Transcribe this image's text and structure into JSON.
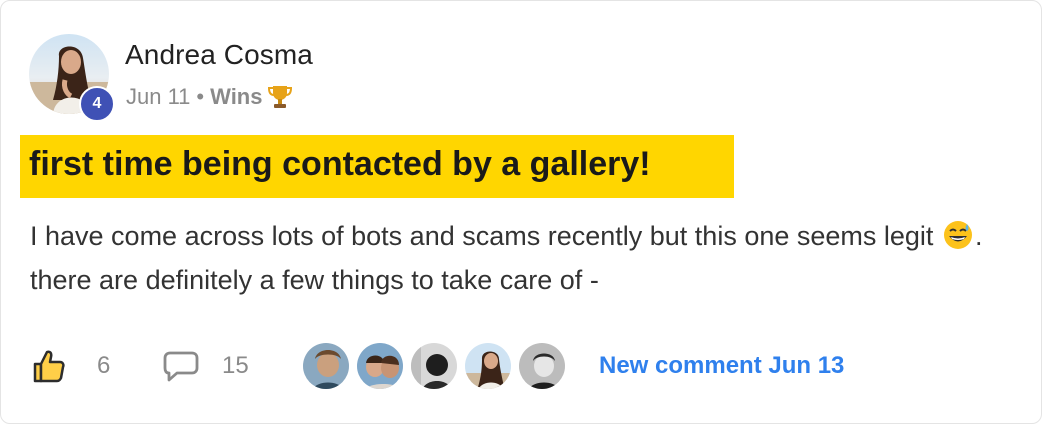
{
  "post": {
    "author": "Andrea Cosma",
    "level": "4",
    "date": "Jun 11",
    "separator": "•",
    "category": "Wins",
    "category_icon": "trophy-icon",
    "title": "first time being contacted by a gallery!",
    "body_part1": "I have come across lots of bots and scams recently but this one seems legit ",
    "body_emoji": "grinning-sweat-emoji",
    "body_part2": ". there are definitely a few things to take care of -"
  },
  "footer": {
    "like_count": "6",
    "comment_count": "15",
    "commenter_avatars": [
      "commenter-avatar-1",
      "commenter-avatar-2",
      "commenter-avatar-3",
      "commenter-avatar-4",
      "commenter-avatar-5"
    ],
    "new_comment": "New comment Jun 13"
  },
  "colors": {
    "highlight": "#ffd600",
    "level_badge": "#3f51b5",
    "link": "#2f80ed"
  }
}
